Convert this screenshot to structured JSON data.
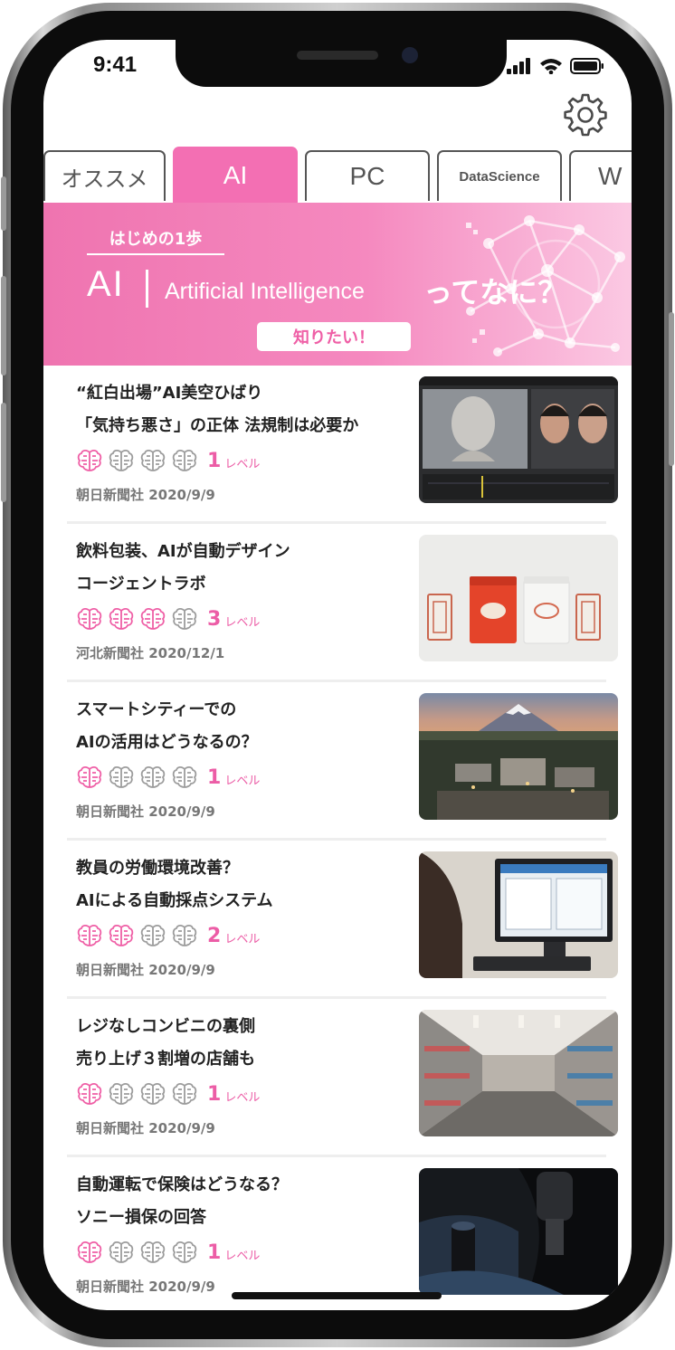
{
  "status_bar": {
    "time": "9:41"
  },
  "tabs": [
    {
      "label": "オススメ",
      "active": false
    },
    {
      "label": "AI",
      "active": true
    },
    {
      "label": "PC",
      "active": false
    },
    {
      "label": "DataScience",
      "active": false
    },
    {
      "label": "W",
      "active": false
    }
  ],
  "banner": {
    "eyebrow": "はじめの1歩",
    "ai": "AI",
    "english": "Artificial Intelligence",
    "question": "ってなに？",
    "button": "知りたい！"
  },
  "articles": [
    {
      "title1": "“紅白出場”AI美空ひばり",
      "title2": "「気持ち悪さ」の正体 法規制は必要か",
      "level": 1,
      "level_unit": "レベル",
      "source": "朝日新聞社 2020/9/9",
      "thumb": "face-3d-modeling-photo"
    },
    {
      "title1": "飲料包装、AIが自動デザイン",
      "title2": "コージェントラボ",
      "level": 3,
      "level_unit": "レベル",
      "source": "河北新聞社 2020/12/1",
      "thumb": "tea-packaging-photo"
    },
    {
      "title1": "スマートシティーでの",
      "title2": "AIの活用はどうなるの？",
      "level": 1,
      "level_unit": "レベル",
      "source": "朝日新聞社 2020/9/9",
      "thumb": "city-mount-fuji-photo"
    },
    {
      "title1": "教員の労働環境改善？",
      "title2": "AIによる自動採点システム",
      "level": 2,
      "level_unit": "レベル",
      "source": "朝日新聞社 2020/9/9",
      "thumb": "computer-monitor-photo"
    },
    {
      "title1": "レジなしコンビニの裏側",
      "title2": "売り上げ３割増の店舗も",
      "level": 1,
      "level_unit": "レベル",
      "source": "朝日新聞社 2020/9/9",
      "thumb": "store-aisle-photo"
    },
    {
      "title1": "自動運転で保険はどうなる？",
      "title2": "ソニー損保の回答",
      "level": 1,
      "level_unit": "レベル",
      "source": "朝日新聞社 2020/9/9",
      "thumb": "car-interior-photo"
    }
  ],
  "colors": {
    "accent": "#ef5fa6",
    "inactive_brain": "#9c9c9c"
  },
  "icons": {
    "settings": "gear-icon",
    "level": "brain-icon"
  }
}
